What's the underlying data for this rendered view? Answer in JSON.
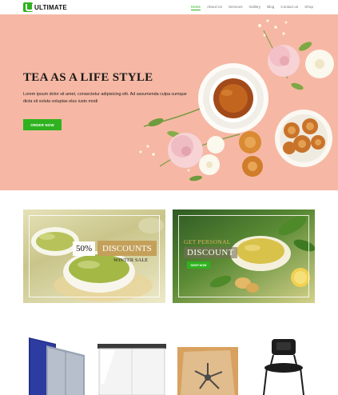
{
  "header": {
    "logo_text": "ULTIMATE",
    "nav": [
      "Home",
      "About Us",
      "Services",
      "Gallery",
      "Blog",
      "Contact us",
      "Shop"
    ],
    "active_nav": "Home"
  },
  "hero": {
    "title": "TEA AS A LIFE STYLE",
    "text": "Lorem ipsum dolor sit amet, consectetur adipisicing elit. Ad assumenda culpa cumque dicta sit soluta voluptas elus iusto modi",
    "button": "ORDER NOW"
  },
  "banners": [
    {
      "percent": "50%",
      "label": "DISCOUNTS",
      "subtitle": "WINTER SALE"
    },
    {
      "heading": "GET PERSONAL",
      "label": "DISCOUNT",
      "button": "SHOP NOW"
    }
  ],
  "products": [
    "room-divider",
    "white-cabinet",
    "office-chair-mat",
    "black-chair"
  ],
  "colors": {
    "accent": "#2fb21f",
    "hero_bg": "#f6b8a4",
    "gold": "#c4a05a"
  }
}
